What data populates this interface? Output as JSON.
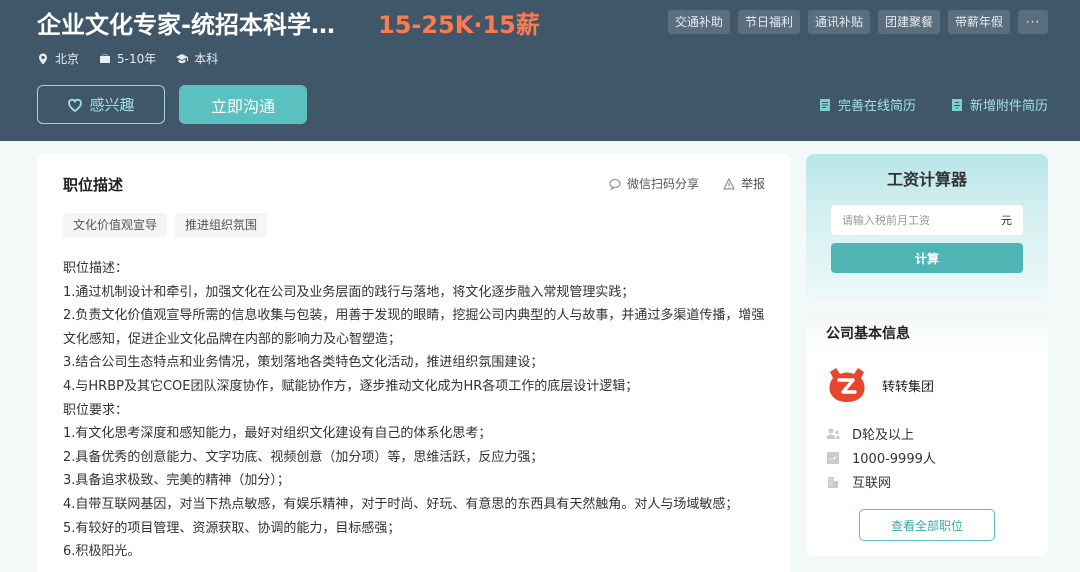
{
  "header": {
    "job_title": "企业文化专家-统招本科学…",
    "salary": "15-25K·15薪",
    "benefits": [
      "交通补助",
      "节日福利",
      "通讯补贴",
      "团建聚餐",
      "带薪年假",
      "···"
    ],
    "location": "北京",
    "experience": "5-10年",
    "education": "本科",
    "interest_label": "感兴趣",
    "chat_label": "立即沟通",
    "online_resume_label": "完善在线简历",
    "attach_resume_label": "新增附件简历"
  },
  "description": {
    "title": "职位描述",
    "share_label": "微信扫码分享",
    "report_label": "举报",
    "tags": [
      "文化价值观宣导",
      "推进组织氛围"
    ],
    "lines": [
      "职位描述：",
      "1.通过机制设计和牵引，加强文化在公司及业务层面的践行与落地，将文化逐步融入常规管理实践；",
      "2.负责文化价值观宣导所需的信息收集与包装，用善于发现的眼睛，挖掘公司内典型的人与故事，并通过多渠道传播，增强文化感知，促进企业文化品牌在内部的影响力及心智塑造；",
      "3.结合公司生态特点和业务情况，策划落地各类特色文化活动，推进组织氛围建设；",
      "4.与HRBP及其它COE团队深度协作，赋能协作方，逐步推动文化成为HR各项工作的底层设计逻辑；",
      "职位要求：",
      "1.有文化思考深度和感知能力，最好对组织文化建设有自己的体系化思考；",
      "2.具备优秀的创意能力、文字功底、视频创意（加分项）等，思维活跃，反应力强；",
      "3.具备追求极致、完美的精神（加分）；",
      "4.自带互联网基因，对当下热点敏感，有娱乐精神，对于时尚、好玩、有意思的东西具有天然触角。对人与场域敏感；",
      "5.有较好的项目管理、资源获取、协调的能力，目标感强；",
      "6.积极阳光。"
    ]
  },
  "calculator": {
    "title": "工资计算器",
    "placeholder": "请输入税前月工资",
    "unit": "元",
    "button_label": "计算"
  },
  "company": {
    "section_title": "公司基本信息",
    "name": "转转集团",
    "stage": "D轮及以上",
    "size": "1000-9999人",
    "industry": "互联网",
    "view_all_label": "查看全部职位",
    "logo_color": "#e8452f"
  }
}
